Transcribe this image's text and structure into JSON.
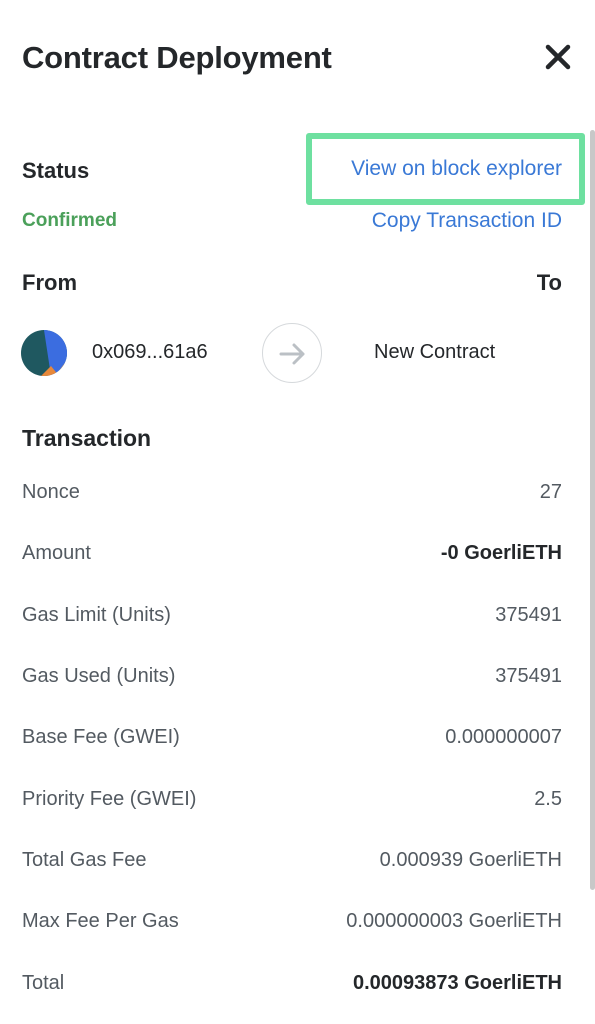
{
  "header": {
    "title": "Contract Deployment",
    "close_icon": "close-icon"
  },
  "status": {
    "label": "Status",
    "value": "Confirmed",
    "value_color": "#4ba05a",
    "view_explorer_link": "View on block explorer",
    "copy_tx_link": "Copy Transaction ID",
    "link_color": "#3a79d6",
    "highlight_color": "#6ee0a0"
  },
  "parties": {
    "from_label": "From",
    "to_label": "To",
    "from_address": "0x069...61a6",
    "to_address": "New Contract",
    "arrow_icon": "arrow-right-icon",
    "avatar_icon": "jazzicon-avatar"
  },
  "transaction": {
    "heading": "Transaction",
    "rows": [
      {
        "label": "Nonce",
        "value": "27"
      },
      {
        "label": "Amount",
        "value": "-0 GoerliETH"
      },
      {
        "label": "Gas Limit (Units)",
        "value": "375491"
      },
      {
        "label": "Gas Used (Units)",
        "value": "375491"
      },
      {
        "label": "Base Fee (GWEI)",
        "value": "0.000000007"
      },
      {
        "label": "Priority Fee (GWEI)",
        "value": "2.5"
      },
      {
        "label": "Total Gas Fee",
        "value": "0.000939 GoerliETH"
      },
      {
        "label": "Max Fee Per Gas",
        "value": "0.000000003 GoerliETH"
      },
      {
        "label": "Total",
        "value": "0.00093873 GoerliETH"
      }
    ]
  }
}
